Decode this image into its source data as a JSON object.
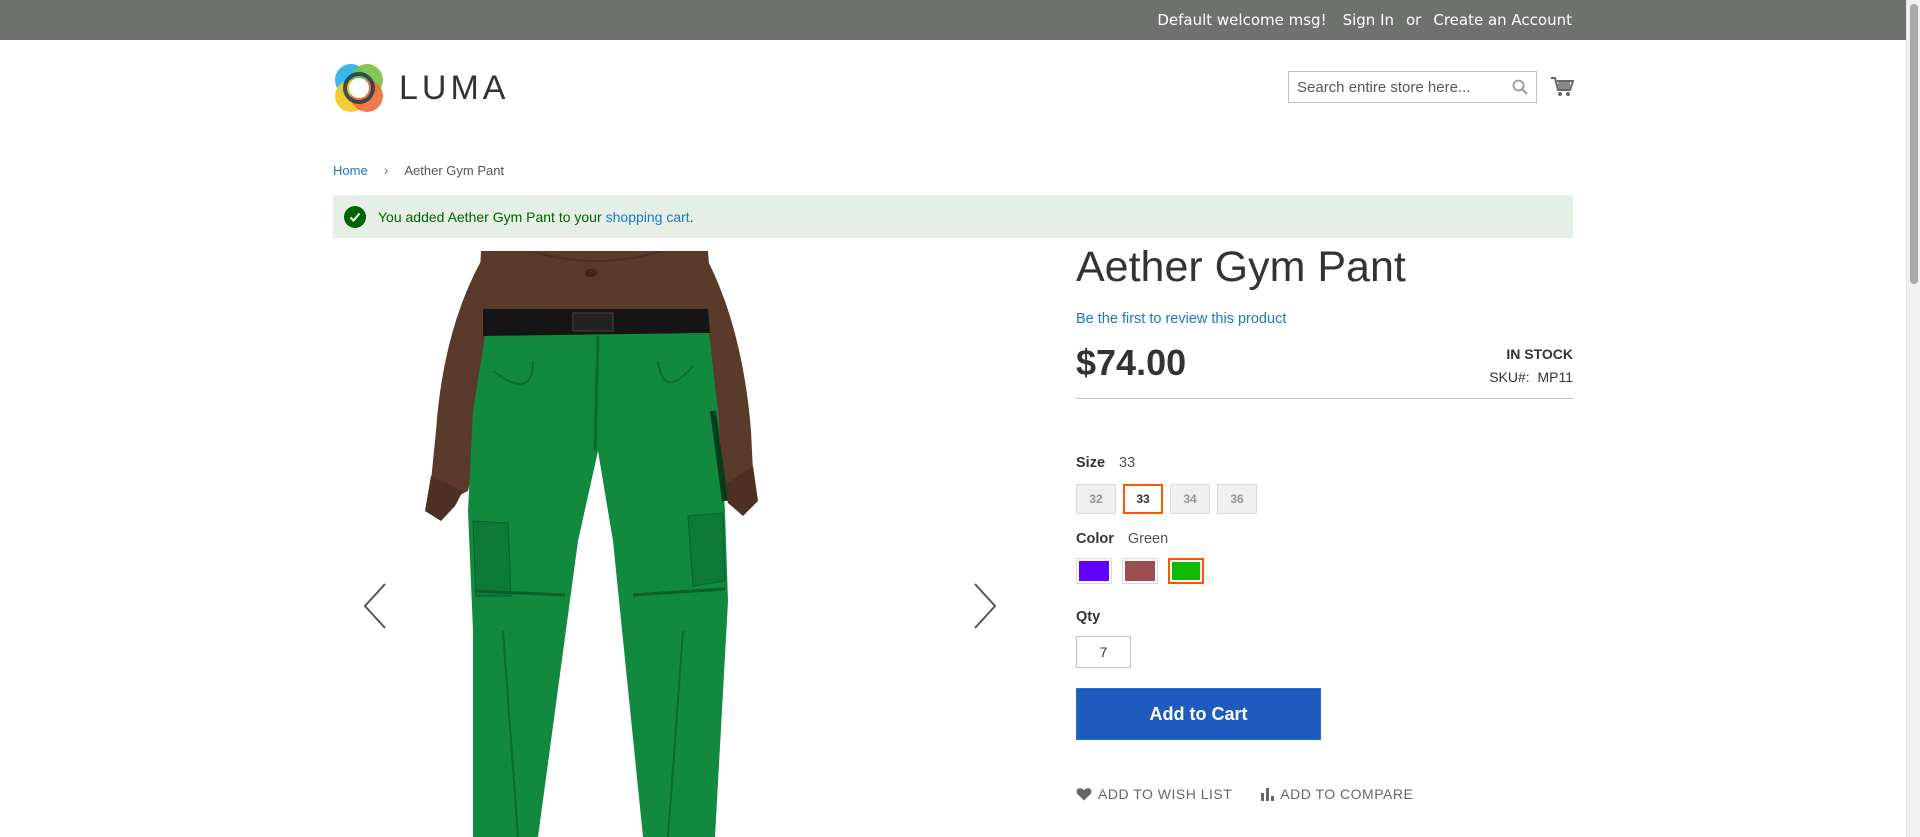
{
  "header": {
    "welcome": "Default welcome msg!",
    "sign_in": "Sign In",
    "or": "or",
    "create_account": "Create an Account"
  },
  "logo": {
    "text": "LUMA"
  },
  "search": {
    "placeholder": "Search entire store here..."
  },
  "breadcrumb": {
    "home": "Home",
    "current": "Aether Gym Pant"
  },
  "message": {
    "prefix": "You added Aether Gym Pant to your ",
    "link": "shopping cart",
    "suffix": "."
  },
  "product": {
    "title": "Aether Gym Pant",
    "review_link": "Be the first to review this product",
    "price": "$74.00",
    "stock": "In stock",
    "sku_label": "SKU#:",
    "sku": "MP11"
  },
  "options": {
    "size_label": "Size",
    "size_selected": "33",
    "sizes": [
      "32",
      "33",
      "34",
      "36"
    ],
    "color_label": "Color",
    "color_selected": "Green",
    "colors": [
      {
        "name": "purple-swatch",
        "hex": "#6100ff"
      },
      {
        "name": "red-swatch",
        "hex": "#9c4d4f"
      },
      {
        "name": "green-swatch",
        "hex": "#11bb00"
      }
    ]
  },
  "qty": {
    "label": "Qty",
    "value": "7"
  },
  "buttons": {
    "add_to_cart": "Add to Cart",
    "wishlist": "Add to Wish List",
    "compare": "Add to Compare"
  },
  "colors": {
    "header_bg": "#6e716e",
    "link": "#1979c3",
    "button": "#1f5bbf",
    "success_bg": "#e5efe5",
    "success_text": "#006400",
    "selected_border": "#ff5501"
  }
}
